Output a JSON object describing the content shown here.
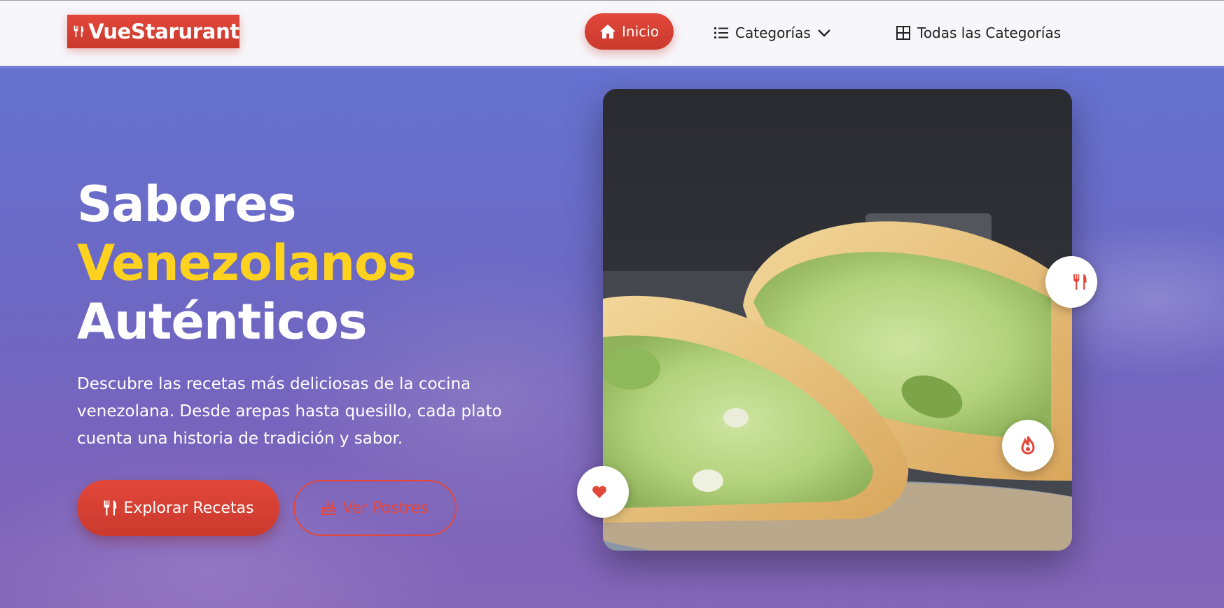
{
  "brand": {
    "name": "VueStarurant"
  },
  "nav": {
    "home": "Inicio",
    "categories": "Categorías",
    "all_categories": "Todas las Categorías"
  },
  "hero": {
    "line1": "Sabores",
    "line2": "Venezolanos",
    "line3": "Auténticos",
    "description": "Descubre las recetas más deliciosas de la cocina venezolana. Desde arepas hasta quesillo, cada plato cuenta una historia de tradición y sabor.",
    "primary_button": "Explorar Recetas",
    "secondary_button": "Ver Postres"
  },
  "image": {
    "subject": "arepas-reina-pepiada"
  },
  "icons": [
    "utensils-icon",
    "home-icon",
    "list-icon",
    "chevron-down-icon",
    "grid-icon",
    "cake-icon",
    "fire-icon",
    "heart-icon"
  ],
  "colors": {
    "accent": "#e2473a",
    "highlight": "#ffd21f",
    "hero_bg": "#6c68c4"
  }
}
